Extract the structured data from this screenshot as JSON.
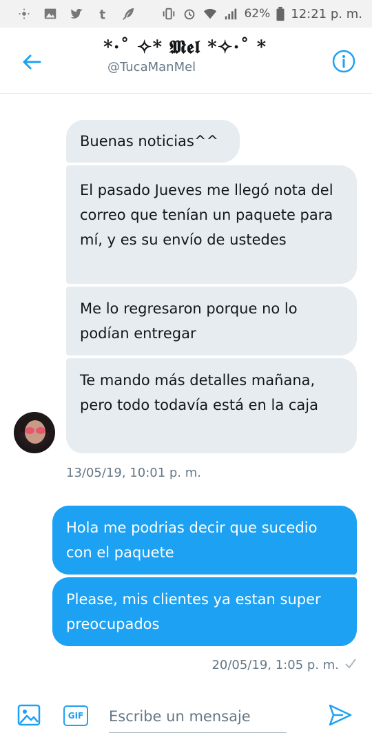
{
  "status_bar": {
    "battery": "62%",
    "time": "12:21 p. m.",
    "icons": [
      "brightness-icon",
      "gallery-icon",
      "twitter-icon",
      "tumblr-icon",
      "feather-icon",
      "vibrate-icon",
      "alarm-icon",
      "wifi-icon",
      "signal-icon",
      "battery-icon"
    ]
  },
  "header": {
    "name": "*·˚ ✧* 𝕸𝖊𝖑 *✧·˚ *",
    "handle": "@TucaManMel"
  },
  "messages": {
    "incoming": [
      "Buenas noticias^^",
      "El pasado Jueves me llegó nota del correo que tenían un paquete para mí, y es su envío de ustedes",
      "Me lo regresaron porque no lo podían entregar",
      "Te mando más detalles mañana, pero todo todavía está en la caja"
    ],
    "incoming_time": "13/05/19, 10:01 p. m.",
    "outgoing": [
      "Hola me podrias decir que sucedio con el paquete",
      "Please, mis clientes ya estan super preocupados"
    ],
    "outgoing_time": "20/05/19, 1:05 p. m."
  },
  "composer": {
    "gif_label": "GIF",
    "placeholder": "Escribe un mensaje"
  },
  "colors": {
    "accent": "#1da1f2",
    "incoming_bubble": "#e6ecf0",
    "secondary_text": "#657786"
  }
}
